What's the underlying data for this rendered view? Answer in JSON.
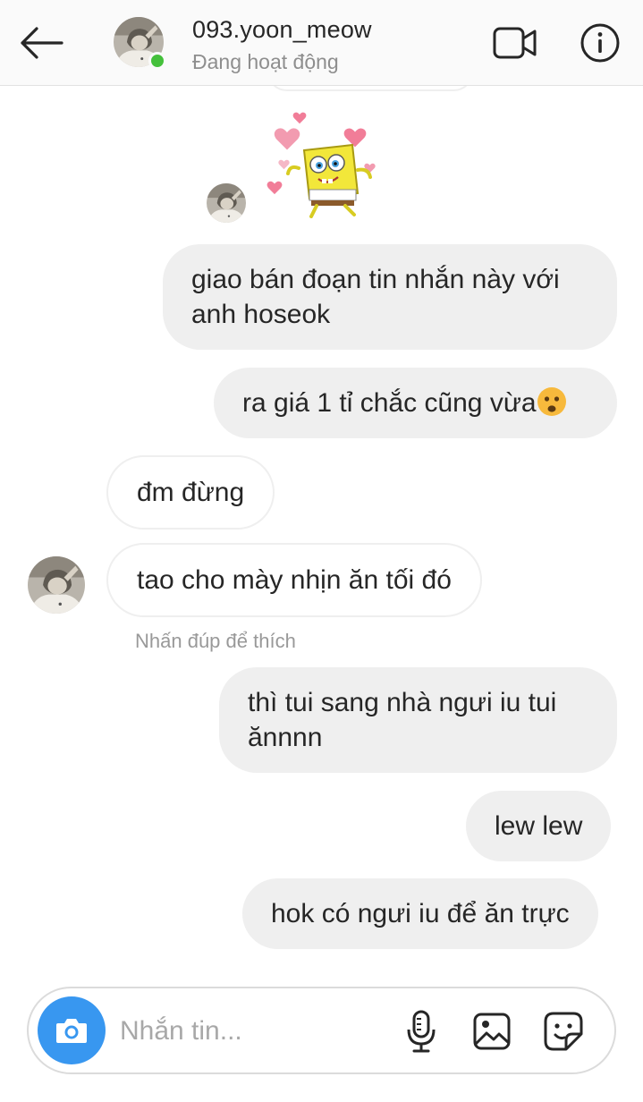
{
  "header": {
    "back_icon": "arrow-left-icon",
    "username": "093.yoon_meow",
    "status": "Đang hoạt động",
    "video_icon": "video-camera-icon",
    "info_icon": "info-icon",
    "online_color": "#44c03b"
  },
  "thread": {
    "sticker_icon": "spongebob-hearts-sticker",
    "messages": [
      {
        "sender": "me",
        "text": "giao bán đoạn tin nhắn này với anh hoseok"
      },
      {
        "sender": "me",
        "text": "ra giá 1 tỉ chắc cũng vừa",
        "emoji": "frowning-face-emoji"
      },
      {
        "sender": "them",
        "text": "đm đừng"
      },
      {
        "sender": "them",
        "text": "tao cho mày nhịn ăn tối đó"
      },
      {
        "sender": "me",
        "text": "thì tui sang nhà ngưi iu tui ănnnn"
      },
      {
        "sender": "me",
        "text": "lew lew"
      },
      {
        "sender": "me",
        "text": "hok có ngưi iu để ăn trực"
      }
    ],
    "like_hint": "Nhấn đúp để thích"
  },
  "composer": {
    "camera_icon": "camera-icon",
    "placeholder": "Nhắn tin...",
    "mic_icon": "microphone-icon",
    "gallery_icon": "image-gallery-icon",
    "sticker_icon": "sticker-icon",
    "accent_color": "#3897f0"
  }
}
